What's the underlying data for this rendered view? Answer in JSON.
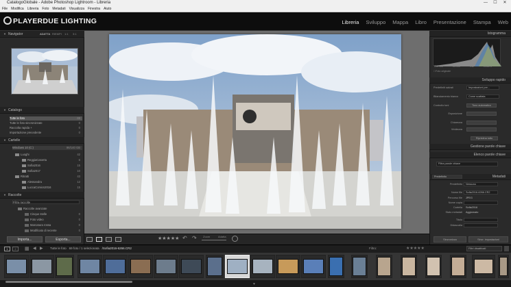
{
  "window": {
    "title": "CatalogoGlobale - Adobe Photoshop Lightroom - Libreria",
    "min": "—",
    "max": "☐",
    "close": "✕"
  },
  "menu": [
    "File",
    "Modifica",
    "Libreria",
    "Foto",
    "Metadati",
    "Visualizza",
    "Finestra",
    "Aiuto"
  ],
  "brand": {
    "logo_text": "PLAYERDUE LIGHTING"
  },
  "modules": [
    "Libreria",
    "Sviluppo",
    "Mappa",
    "Libro",
    "Presentazione",
    "Stampa",
    "Web"
  ],
  "left": {
    "navigator": {
      "title": "Navigator",
      "zoom": [
        "ADATTA",
        "RIEMPI",
        "1:1",
        "3:1"
      ]
    },
    "catalog": {
      "title": "Catalogo",
      "items": [
        {
          "label": "Tutte le foto",
          "count": "69"
        },
        {
          "label": "Tutte le foto sincronizzate",
          "count": "0"
        },
        {
          "label": "Raccolta rapida +",
          "count": "0"
        },
        {
          "label": "Importazione precedente",
          "count": "0"
        }
      ]
    },
    "folders_title": "Cartelle",
    "volume": {
      "label": "Windows 10 (C:)",
      "info": "86/140 GB"
    },
    "folders": [
      {
        "label": "Luoghi",
        "count": "42",
        "level": 1
      },
      {
        "label": "ReggiaCaserta",
        "count": "6",
        "level": 2
      },
      {
        "label": "Sofia2016",
        "count": "15",
        "level": 2
      },
      {
        "label": "Sofia2017",
        "count": "10",
        "level": 2
      },
      {
        "label": "Ritratti",
        "count": "43",
        "level": 1
      },
      {
        "label": "Alessandra",
        "count": "12",
        "level": 2
      },
      {
        "label": "LuccaComics2016",
        "count": "15",
        "level": 2
      }
    ],
    "collections_title": "Raccolte",
    "collections": [
      {
        "label": "Filtra raccolte",
        "count": "",
        "level": 0
      },
      {
        "label": "Raccolte avanzate",
        "count": "",
        "level": 1
      },
      {
        "label": "Cinque stelle",
        "count": "0",
        "level": 2
      },
      {
        "label": "Foto video",
        "count": "0",
        "level": 2
      },
      {
        "label": "Marcatura rossa",
        "count": "0",
        "level": 2
      },
      {
        "label": "Modificato di recente",
        "count": "0",
        "level": 2
      }
    ],
    "import_label": "Importa...",
    "export_label": "Esporta..."
  },
  "toolbar": {
    "rating": "★★★★★",
    "zoom_label": "Zoom",
    "zoom_value": "Adatta"
  },
  "right": {
    "histogram": {
      "title": "Istogramma",
      "exif": [
        "ISO 100",
        "24 mm",
        "f/11",
        "1/160 s"
      ],
      "original_label": "Foto originale"
    },
    "quick_dev": {
      "title": "Sviluppo rapido",
      "preset_label": "Predefiniti salvati",
      "preset_value": "Impostazioni pre...",
      "wb_label": "Bilanciamento bianco",
      "wb_value": "Come scattata",
      "tone_label": "Controllo toni",
      "tone_btn": "Tono automatico",
      "rows": [
        "Esposizione",
        "Chiarezza",
        "Vividezza"
      ],
      "reset_label": "Ripristina tutto"
    },
    "keywording_title": "Gestione parole chiave",
    "keyword_list_title": "Elenco parole chiave",
    "keyword_filter": "Filtra parole chiave",
    "metadata_title": "Metadati",
    "metadata_preset": "Predefinito",
    "metadata_preset_value": "Nessuno",
    "metadata": [
      {
        "label": "Nome file",
        "value": "Sofia2016-6266.CR2"
      },
      {
        "label": "Percorso file",
        "value": "JPEG"
      },
      {
        "label": "Nome copia",
        "value": ""
      },
      {
        "label": "Cartella",
        "value": "Sofia2016"
      },
      {
        "label": "Stato metadati",
        "value": "Aggiornato"
      },
      {
        "label": "Titolo",
        "value": ""
      },
      {
        "label": "Didascalia",
        "value": ""
      }
    ],
    "sync_meta": "Sincronizza",
    "sync_settings": "Sincr. impostazioni"
  },
  "filmstrip_bar": {
    "pages": [
      "1",
      "2"
    ],
    "source": "Tutte le foto",
    "info": "69 foto / 1 selezionata",
    "filename": "/Sofia2016-6266.CR2",
    "filter_label": "Filtro:",
    "filter_value": "Filtri disattivati"
  },
  "colors": {
    "accent": "#eeeeee",
    "panel": "#2a2a2a",
    "selected_thumb": "#d8d8d8"
  }
}
